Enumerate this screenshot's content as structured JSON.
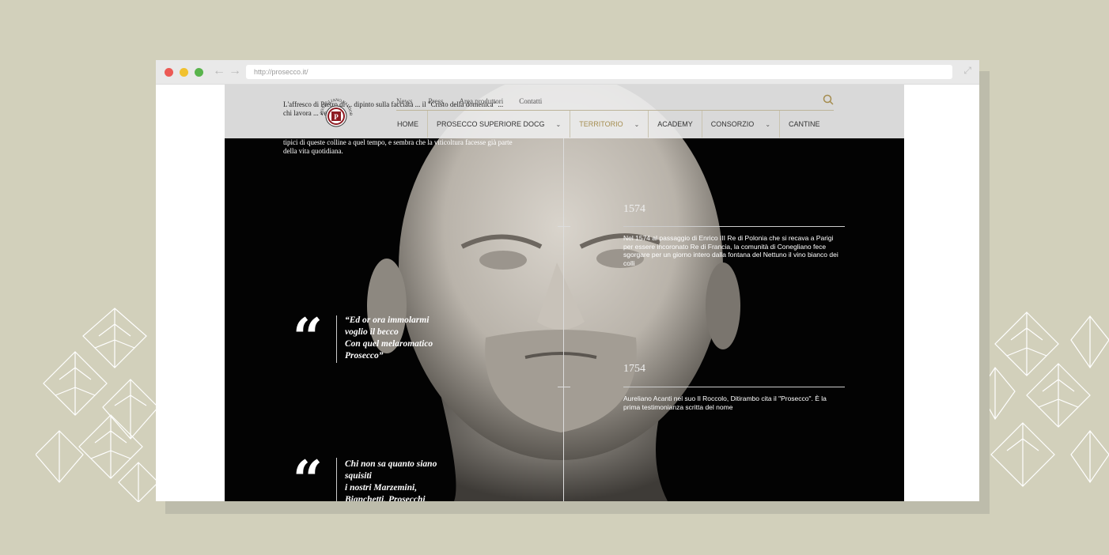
{
  "browser": {
    "url": "http://prosecco.it/",
    "back_icon": "←",
    "forward_icon": "→",
    "expand_icon": "⤢"
  },
  "site": {
    "logo_text": "CONEGLIANO VALDOBBIADENE DOCG",
    "top_nav": [
      "News",
      "Press",
      "Area produttori",
      "Contatti"
    ],
    "main_nav": [
      {
        "label": "HOME",
        "dropdown": false,
        "active": false
      },
      {
        "label": "PROSECCO SUPERIORE DOCG",
        "dropdown": true,
        "active": false
      },
      {
        "label": "TERRITORIO",
        "dropdown": true,
        "active": true
      },
      {
        "label": "ACADEMY",
        "dropdown": false,
        "active": false
      },
      {
        "label": "CONSORZIO",
        "dropdown": true,
        "active": false
      },
      {
        "label": "CANTINE",
        "dropdown": false,
        "active": false
      }
    ],
    "intro_text": "L'affresco di Pietro di ... dipinto sulla facciata ... il \"Cristo della domenica\" ... chi lavora ... verso i ... ",
    "intro_tail": "tipici di queste colline a quel tempo, e sembra che la viticoltura facesse già parte della vita quotidiana.",
    "timeline": [
      {
        "year": "1574",
        "text": "Nel 1574 al passaggio di Enrico III Re di Polonia che si recava a Parigi per essere incoronato Re di Francia, la comunità di Conegliano fece sgorgare per un giorno intero dalla fontana del Nettuno il vino bianco dei colli"
      },
      {
        "year": "1754",
        "text": "Aureliano Acanti nel suo Il Roccolo, Ditirambo cita il \"Prosecco\". È la prima testimonianza scritta del nome"
      }
    ],
    "quotes": [
      {
        "mark": "“",
        "text": [
          "“Ed or ora immolarmi",
          "voglio il becco",
          "Con quel melaromatico",
          "Prosecco”"
        ]
      },
      {
        "mark": "“",
        "text": [
          "Chi non sa quanto siano",
          "squisiti",
          "i nostri Marzemini,",
          "Bianchetti, Prosecchi"
        ]
      }
    ]
  },
  "colors": {
    "background": "#d2d0bb",
    "accent_gold": "#a58d4f",
    "logo_red": "#8e1b22"
  }
}
